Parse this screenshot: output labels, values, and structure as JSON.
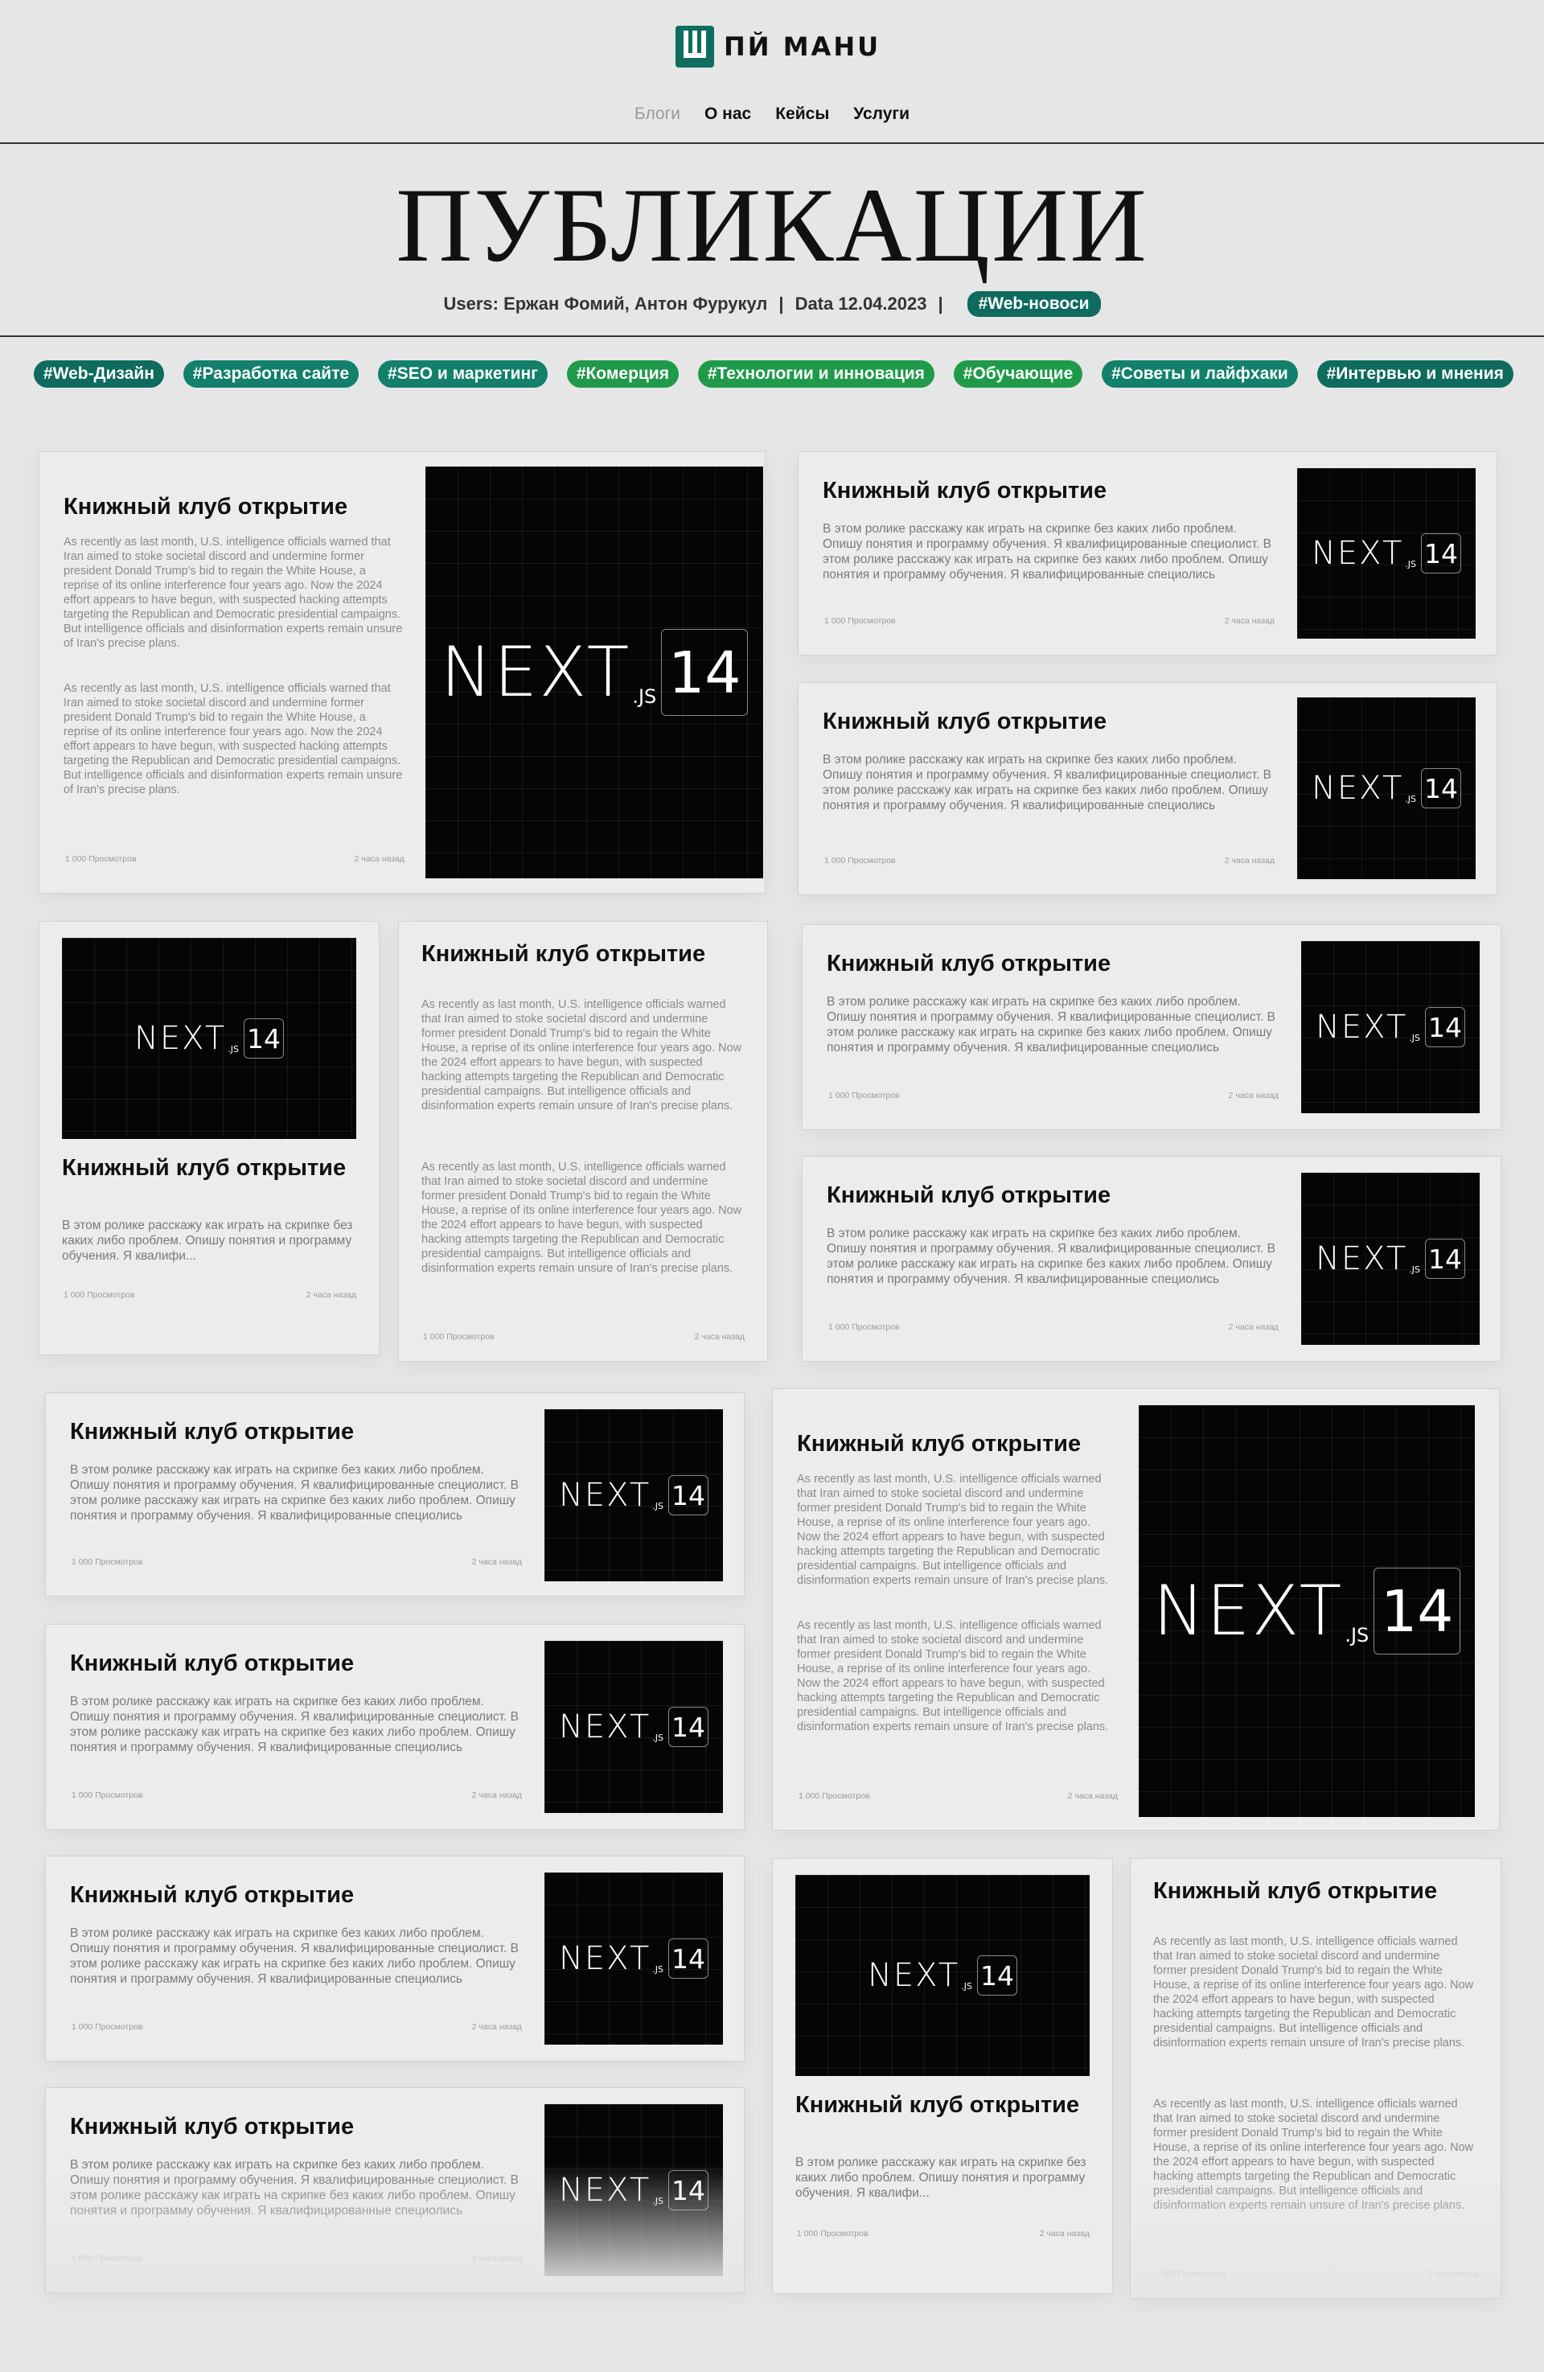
{
  "header": {
    "logo_text": "ПЙ МАНU",
    "nav": [
      "Блоги",
      "О нас",
      "Кейсы",
      "Услуги"
    ]
  },
  "page": {
    "title": "ПУБЛИКАЦИИ",
    "users": "Users: Ержан Фомий, Антон Фурукул",
    "sep": "|",
    "date": "Data 12.04.2023",
    "tag": "#Web-новоси"
  },
  "tags": [
    "#Web-Дизайн",
    "#Разработка сайте",
    "#SEO и маркетинг",
    "#Комерция",
    "#Технологии и инновация",
    "#Обучающие",
    "#Советы и лайфхаки",
    "#Интервью и мнения"
  ],
  "card": {
    "title": "Книжный клуб открытие",
    "text_en": "As recently as last month, U.S. intelligence officials warned that Iran aimed to stoke societal discord and undermine former president Donald Trump's bid to regain the White House, a reprise of its online interference four years ago. Now the 2024 effort appears to have begun, with suspected hacking attempts targeting the Republican and Democratic presidential campaigns. But intelligence officials and disinformation experts remain unsure of Iran's precise plans.",
    "text_ru": "В этом ролике расскажу как играть на скрипке без каких либо проблем. Опишу понятия и программу обучения. Я квалифицированные специолист. В этом ролике расскажу как играть на скрипке без каких либо проблем. Опишу понятия и программу обучения. Я квалифицированные специолись",
    "text_ru_short": "В этом ролике расскажу как играть на скрипке без каких либо проблем. Опишу понятия и программу обучения. Я квалифи...",
    "views": "1 000 Просмотров",
    "time": "2 часа назад"
  },
  "thumb": {
    "word": "NEXT",
    "js": ".JS",
    "num": "14"
  }
}
